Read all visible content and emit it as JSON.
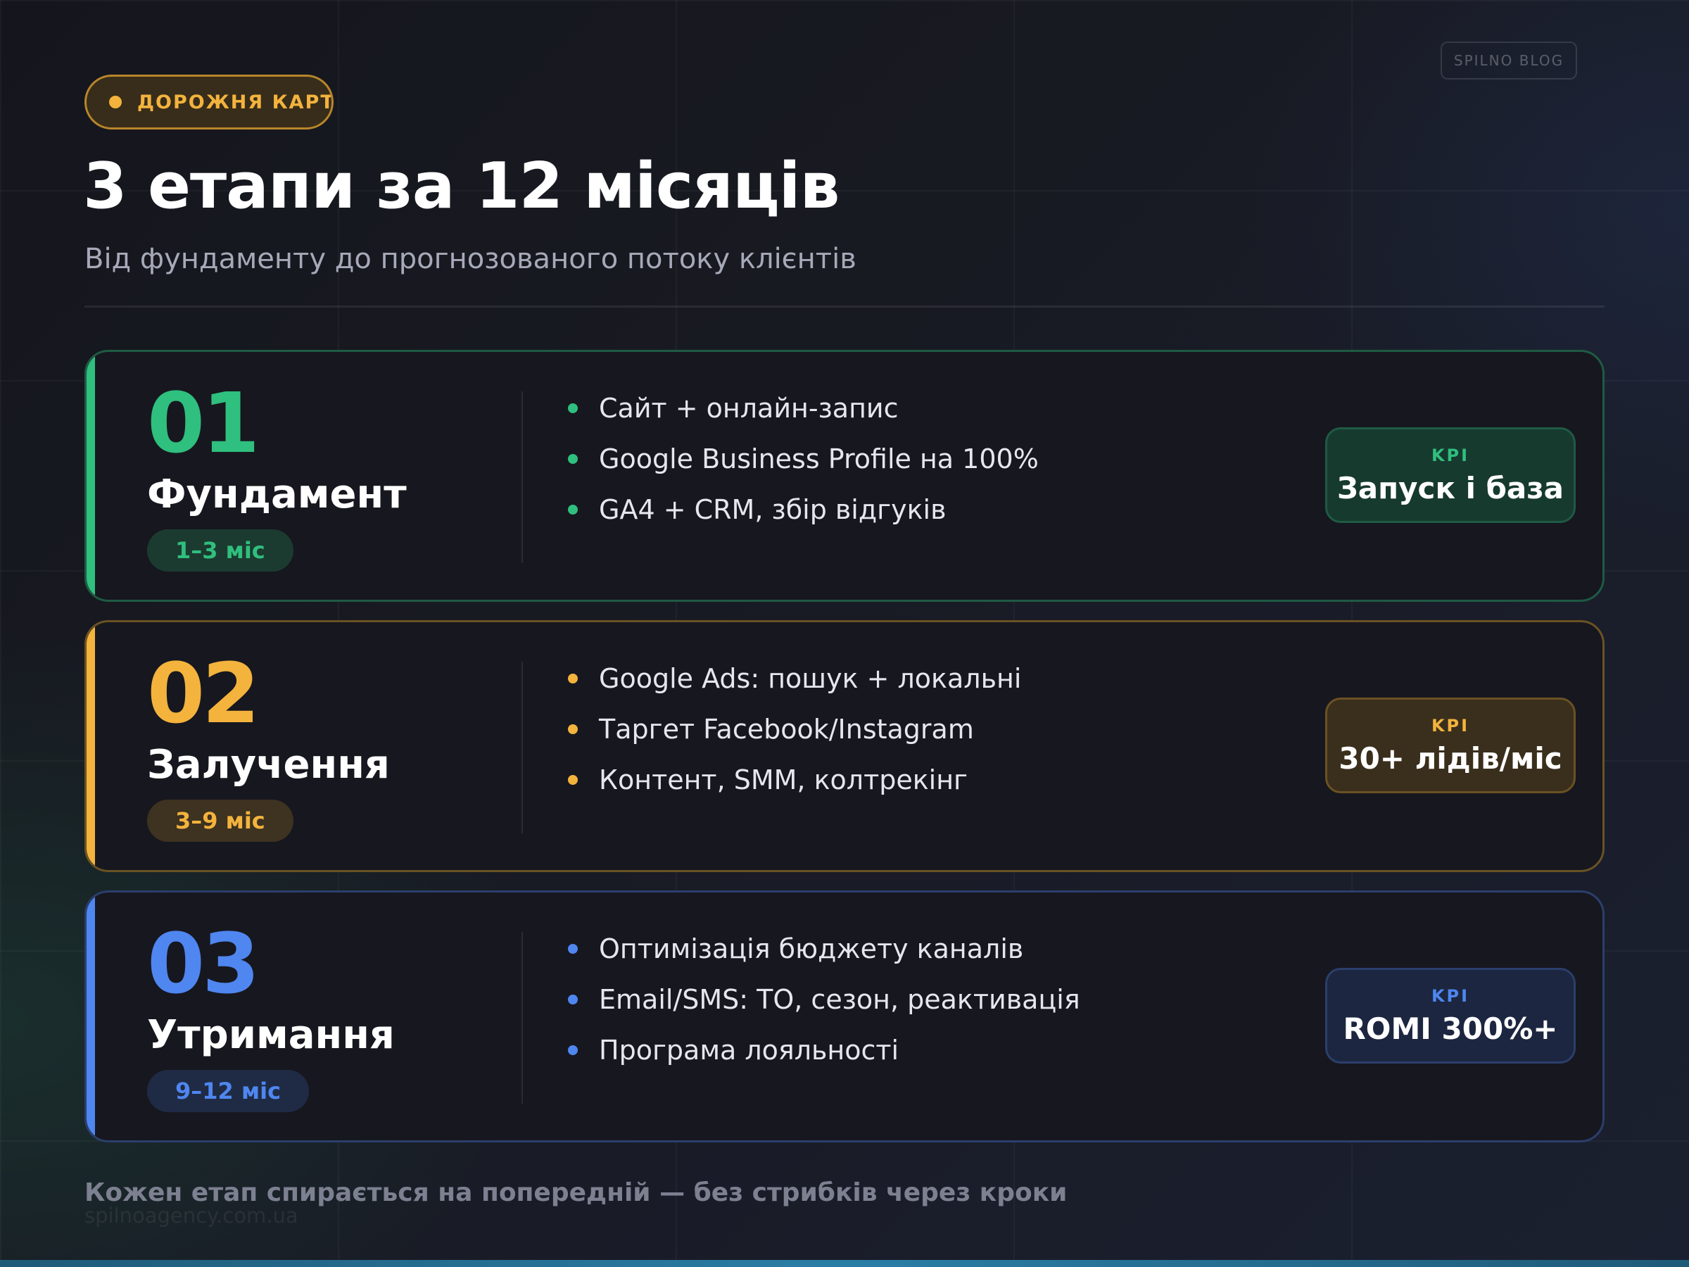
{
  "brand_badge": "SPILNO BLOG",
  "tag": {
    "label": "ДОРОЖНЯ КАРТА"
  },
  "title": "3 етапи за 12 місяців",
  "subtitle": "Від фундаменту до прогнозованого потоку клієнтів",
  "stages": [
    {
      "number": "01",
      "name": "Фундамент",
      "period": "1–3 міс",
      "accent": "#2fbf7e",
      "border": "#1f5a44",
      "period_bg": "#1c3b30",
      "kpi_bg": "#173a2f",
      "bullets": [
        "Сайт + онлайн-запис",
        "Google Business Profile на 100%",
        "GA4 + CRM, збір відгуків"
      ],
      "kpi_label": "KPI",
      "kpi_value": "Запуск і база"
    },
    {
      "number": "02",
      "name": "Залучення",
      "period": "3–9 міс",
      "accent": "#f3b33d",
      "border": "#6a5223",
      "period_bg": "#3e3220",
      "kpi_bg": "#3a2f1c",
      "bullets": [
        "Google Ads: пошук + локальні",
        "Таргет Facebook/Instagram",
        "Контент, SMM, колтрекінг"
      ],
      "kpi_label": "KPI",
      "kpi_value": "30+ лідів/міс"
    },
    {
      "number": "03",
      "name": "Утримання",
      "period": "9–12 міс",
      "accent": "#4f86f0",
      "border": "#2b3f6c",
      "period_bg": "#1f2b45",
      "kpi_bg": "#1c2640",
      "bullets": [
        "Оптимізація бюджету каналів",
        "Email/SMS: ТО, сезон, реактивація",
        "Програма лояльності"
      ],
      "kpi_label": "KPI",
      "kpi_value": "ROMI 300%+"
    }
  ],
  "footer_note": "Кожен етап спирається на попередній — без стрибків через кроки",
  "footer_site": "spilnoagency.com.ua"
}
